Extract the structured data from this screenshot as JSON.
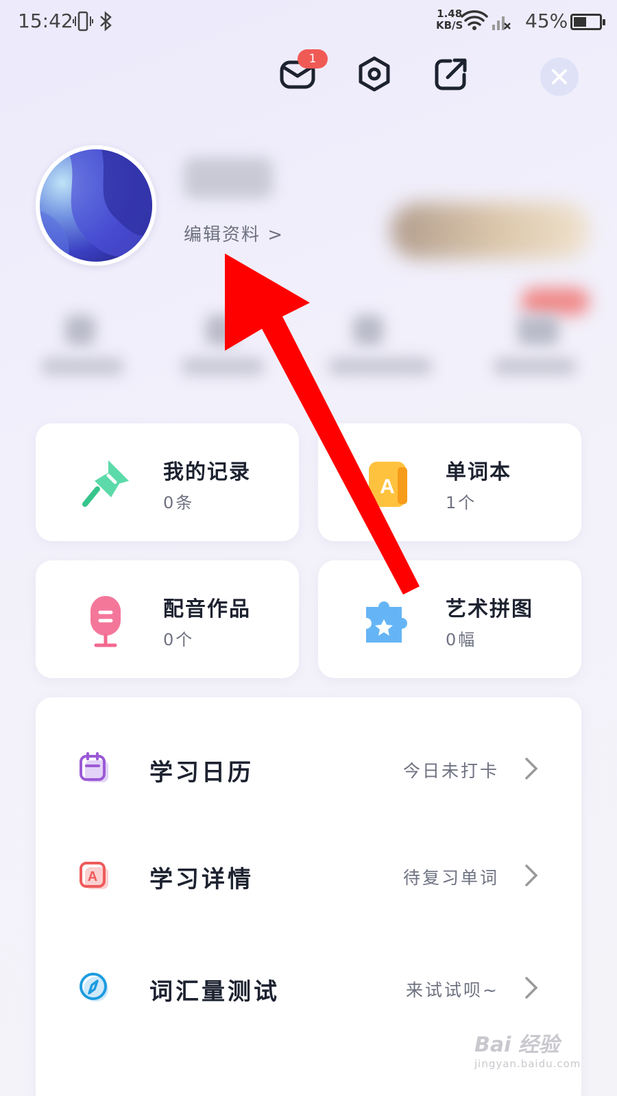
{
  "status_bar": {
    "time": "15:42",
    "net_speed_value": "1.48",
    "net_speed_unit": "KB/S",
    "battery_pct": "45%"
  },
  "header": {
    "mail_badge": "1",
    "icons": [
      "mail-icon",
      "settings-icon",
      "share-icon",
      "close-icon"
    ]
  },
  "profile": {
    "edit_label": "编辑资料 >"
  },
  "cards": [
    {
      "title": "我的记录",
      "sub": "0条",
      "icon": "pin-icon",
      "color": "#3fd39a"
    },
    {
      "title": "单词本",
      "sub": "1个",
      "icon": "wordbook-icon",
      "color": "#ffb534"
    },
    {
      "title": "配音作品",
      "sub": "0个",
      "icon": "microphone-icon",
      "color": "#f3688f"
    },
    {
      "title": "艺术拼图",
      "sub": "0幅",
      "icon": "puzzle-icon",
      "color": "#4aa8f5"
    }
  ],
  "menu": [
    {
      "label": "学习日历",
      "status": "今日未打卡",
      "icon": "calendar-icon",
      "color": "#9b59d6"
    },
    {
      "label": "学习详情",
      "status": "待复习单词",
      "icon": "study-detail-icon",
      "color": "#ee5b5b"
    },
    {
      "label": "词汇量测试",
      "status": "来试试呗~",
      "icon": "compass-icon",
      "color": "#1e9be0"
    }
  ],
  "watermark": {
    "main": "Bai 经验",
    "sub": "jingyan.baidu.com"
  },
  "accent": {
    "arrow": "#ff0000",
    "badge": "#f05a55"
  }
}
